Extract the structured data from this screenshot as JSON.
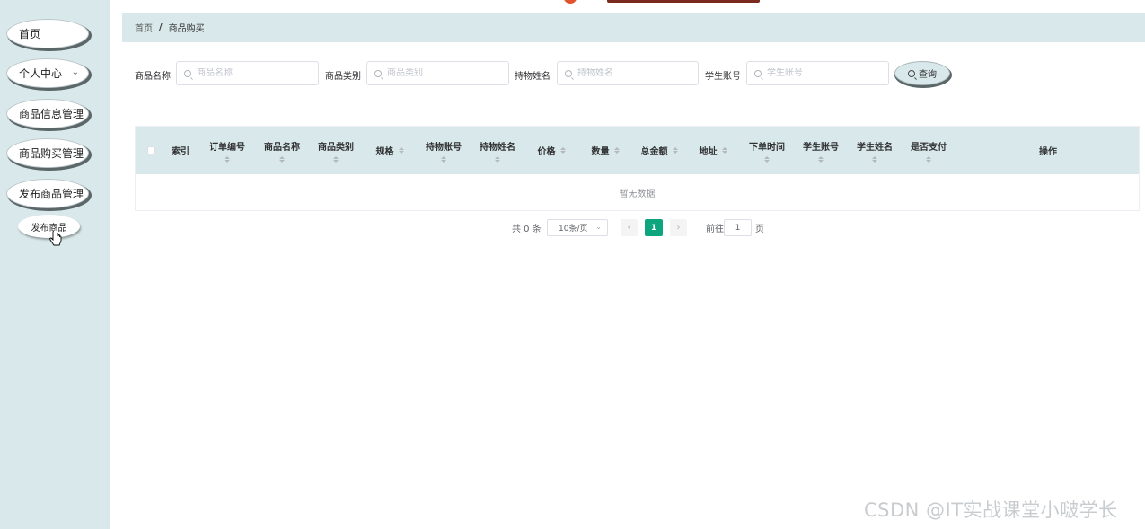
{
  "sidebar": {
    "items": [
      {
        "label": "首页"
      },
      {
        "label": "个人中心"
      },
      {
        "label": "商品信息管理"
      },
      {
        "label": "商品购买管理"
      },
      {
        "label": "发布商品管理"
      }
    ],
    "sub_item": {
      "label": "发布商品"
    }
  },
  "breadcrumb": {
    "home": "首页",
    "separator": "/",
    "current": "商品购买"
  },
  "search": {
    "fields": [
      {
        "label": "商品名称",
        "placeholder": "商品名称"
      },
      {
        "label": "商品类别",
        "placeholder": "商品类别"
      },
      {
        "label": "持物姓名",
        "placeholder": "持物姓名"
      },
      {
        "label": "学生账号",
        "placeholder": "学生账号"
      }
    ],
    "button": "查询"
  },
  "table": {
    "columns": [
      "索引",
      "订单编号",
      "商品名称",
      "商品类别",
      "规格",
      "持物账号",
      "持物姓名",
      "价格",
      "数量",
      "总金额",
      "地址",
      "下单时间",
      "学生账号",
      "学生姓名",
      "是否支付",
      "操作"
    ],
    "empty_text": "暂无数据"
  },
  "pagination": {
    "total": "共 0 条",
    "page_size": "10条/页",
    "current_page": "1",
    "goto_prefix": "前往",
    "goto_value": "1",
    "goto_suffix": "页"
  },
  "watermark": "CSDN @IT实战课堂小啵学长",
  "colors": {
    "sidebar_bg": "#d9e8ea",
    "header_bg": "#d9e8ea",
    "active_page": "#0da57e"
  }
}
